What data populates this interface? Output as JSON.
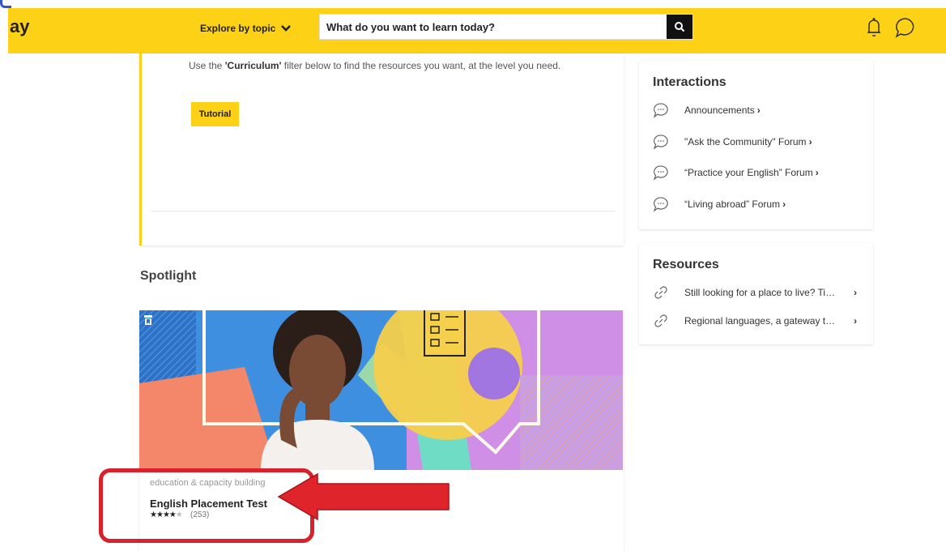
{
  "header": {
    "logo_text": "ay",
    "explore_label": "Explore by topic",
    "search_placeholder": "What do you want to learn today?"
  },
  "intro_card": {
    "text_before": "Use the ",
    "text_bold": "'Curriculum'",
    "text_after": " filter below to find the resources you want, at the level you need.",
    "tutorial_label": "Tutorial"
  },
  "spotlight": {
    "heading": "Spotlight",
    "card": {
      "category": "education & capacity building",
      "title": "English Placement Test",
      "rating_stars": 4,
      "rating_max": 5,
      "rating_count": "(253)"
    }
  },
  "interactions": {
    "heading": "Interactions",
    "items": [
      {
        "label": "Announcements",
        "icon": "speech-bubble-icon"
      },
      {
        "label": "\"Ask the Community\" Forum",
        "icon": "speech-bubble-icon"
      },
      {
        "label": "“Practice your English” Forum",
        "icon": "speech-bubble-icon"
      },
      {
        "label": "“Living abroad” Forum",
        "icon": "speech-bubble-icon"
      }
    ]
  },
  "resources": {
    "heading": "Resources",
    "items": [
      {
        "label": "Still looking for a place to live? Ti…",
        "icon": "link-icon"
      },
      {
        "label": "Regional languages, a gateway t…",
        "icon": "link-icon"
      }
    ]
  },
  "colors": {
    "brand_yellow": "#fcd116",
    "highlight_red": "#d9212c"
  }
}
